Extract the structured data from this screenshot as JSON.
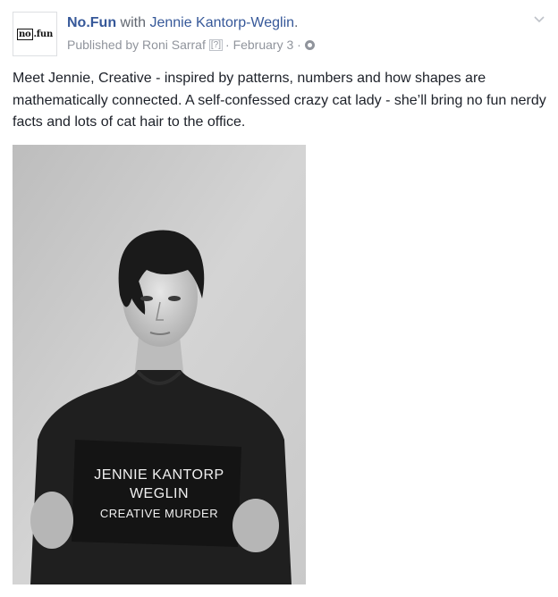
{
  "header": {
    "page_name": "No.Fun",
    "with_word": "with",
    "tagged_name": "Jennie Kantorp-Weglin",
    "end_dot": ".",
    "published_by": "Published by Roni Sarraf",
    "help_mark": "[?]",
    "sep1": "·",
    "date": "February 3",
    "sep2": "·",
    "avatar_logo": "no.fun"
  },
  "post": {
    "text": "Meet Jennie, Creative - inspired by patterns, numbers and how shapes are mathematically connected. A self-confessed crazy cat lady - she’ll bring no fun nerdy facts and lots of cat hair to the office."
  },
  "photo": {
    "sign_line1": "JENNIE KANTORP",
    "sign_line2": "WEGLIN",
    "sign_line3": "CREATIVE MURDER"
  },
  "icons": {
    "audience": "globe-icon",
    "menu": "chevron-down-icon"
  }
}
